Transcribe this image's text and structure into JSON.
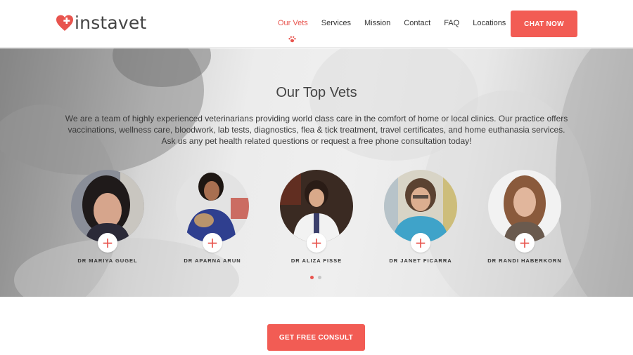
{
  "brand": {
    "name": "instavet",
    "logo_icon": "heart-plus-icon",
    "accent_color": "#f25c54"
  },
  "nav": {
    "items": [
      {
        "label": "Our Vets",
        "active": true
      },
      {
        "label": "Services",
        "active": false
      },
      {
        "label": "Mission",
        "active": false
      },
      {
        "label": "Contact",
        "active": false
      },
      {
        "label": "FAQ",
        "active": false
      },
      {
        "label": "Locations",
        "active": false
      }
    ],
    "active_indicator_icon": "paw-icon",
    "chat_label": "CHAT NOW"
  },
  "hero": {
    "title": "Our Top Vets",
    "description": "We are a team of highly experienced veterinarians providing world class care in the comfort of home or local clinics.  Our practice offers vaccinations, wellness care, bloodwork, lab tests, diagnostics, flea & tick treatment, travel certificates, and home euthanasia services. Ask us any pet health related questions or request a free phone consultation today!"
  },
  "vets": [
    {
      "name": "DR MARIYA GUGEL",
      "plus_icon": "plus-icon"
    },
    {
      "name": "DR APARNA ARUN",
      "plus_icon": "plus-icon"
    },
    {
      "name": "DR ALIZA FISSE",
      "plus_icon": "plus-icon"
    },
    {
      "name": "DR JANET FICARRA",
      "plus_icon": "plus-icon"
    },
    {
      "name": "DR RANDI HABERKORN",
      "plus_icon": "plus-icon"
    }
  ],
  "carousel": {
    "pages": 2,
    "current_page": 1
  },
  "cta": {
    "label": "GET FREE CONSULT"
  }
}
